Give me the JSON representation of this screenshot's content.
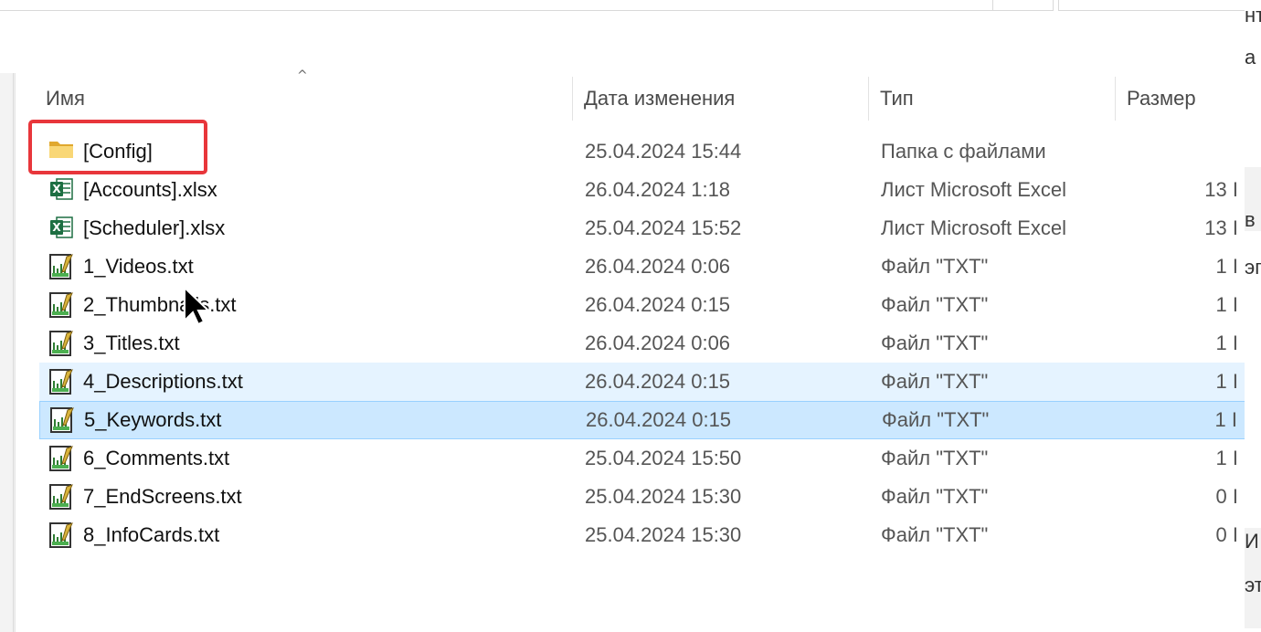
{
  "columns": {
    "name": "Имя",
    "date": "Дата изменения",
    "type": "Тип",
    "size": "Размер"
  },
  "files": [
    {
      "name": "[Config]",
      "date": "25.04.2024 15:44",
      "type": "Папка с файлами",
      "size": "",
      "icon": "folder-icon"
    },
    {
      "name": "[Accounts].xlsx",
      "date": "26.04.2024 1:18",
      "type": "Лист Microsoft Excel",
      "size": "13 I",
      "icon": "excel-icon"
    },
    {
      "name": "[Scheduler].xlsx",
      "date": "25.04.2024 15:52",
      "type": "Лист Microsoft Excel",
      "size": "13 I",
      "icon": "excel-icon"
    },
    {
      "name": "1_Videos.txt",
      "date": "26.04.2024 0:06",
      "type": "Файл \"TXT\"",
      "size": "1 I",
      "icon": "text-file-icon"
    },
    {
      "name": "2_Thumbnails.txt",
      "date": "26.04.2024 0:15",
      "type": "Файл \"TXT\"",
      "size": "1 I",
      "icon": "text-file-icon"
    },
    {
      "name": "3_Titles.txt",
      "date": "26.04.2024 0:06",
      "type": "Файл \"TXT\"",
      "size": "1 I",
      "icon": "text-file-icon"
    },
    {
      "name": "4_Descriptions.txt",
      "date": "26.04.2024 0:15",
      "type": "Файл \"TXT\"",
      "size": "1 I",
      "icon": "text-file-icon",
      "state": "hover"
    },
    {
      "name": "5_Keywords.txt",
      "date": "26.04.2024 0:15",
      "type": "Файл \"TXT\"",
      "size": "1 I",
      "icon": "text-file-icon",
      "state": "selected"
    },
    {
      "name": "6_Comments.txt",
      "date": "25.04.2024 15:50",
      "type": "Файл \"TXT\"",
      "size": "1 I",
      "icon": "text-file-icon"
    },
    {
      "name": "7_EndScreens.txt",
      "date": "25.04.2024 15:30",
      "type": "Файл \"TXT\"",
      "size": "0 I",
      "icon": "text-file-icon"
    },
    {
      "name": "8_InfoCards.txt",
      "date": "25.04.2024 15:30",
      "type": "Файл \"TXT\"",
      "size": "0 I",
      "icon": "text-file-icon"
    }
  ],
  "right_fragments": [
    "нт",
    "а",
    "в",
    "эг",
    "И",
    "эт"
  ],
  "colors": {
    "highlight_box": "#e8363b",
    "selected_row": "#cce8ff",
    "hover_row": "#e5f3ff",
    "excel_green": "#1d6f42",
    "folder_yellow": "#f4c64b"
  }
}
